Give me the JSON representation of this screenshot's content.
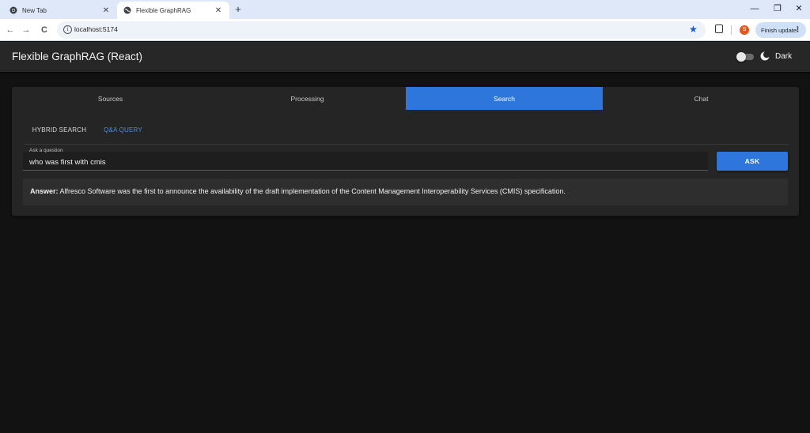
{
  "browser": {
    "tabs": [
      {
        "title": "New Tab",
        "icon": "chrome-icon",
        "active": false
      },
      {
        "title": "Flexible GraphRAG",
        "icon": "globe-icon",
        "active": true
      }
    ],
    "tab_close": "✕",
    "new_tab": "+",
    "window_controls": {
      "minimize": "—",
      "restore": "❐",
      "close": "✕"
    },
    "nav": {
      "back": "←",
      "forward": "→",
      "reload": "C"
    },
    "url": "localhost:5174",
    "info_icon": "i",
    "bookmark_icon": "★",
    "profile_initial": "S",
    "finish_update": "Finish update",
    "menu_icon": "⋮"
  },
  "app": {
    "title": "Flexible GraphRAG (React)",
    "theme_label": "Dark",
    "theme_dark_enabled": false,
    "tabs": [
      {
        "label": "Sources",
        "active": false
      },
      {
        "label": "Processing",
        "active": false
      },
      {
        "label": "Search",
        "active": true
      },
      {
        "label": "Chat",
        "active": false
      }
    ],
    "subtabs": [
      {
        "label": "HYBRID SEARCH",
        "active": false
      },
      {
        "label": "Q&A QUERY",
        "active": true
      }
    ],
    "question": {
      "label": "Ask a question",
      "value": "who was first with cmis"
    },
    "ask_button": "ASK",
    "answer": {
      "label": "Answer:",
      "text": "Alfresco Software was the first to announce the availability of the draft implementation of the Content Management Interoperability Services (CMIS) specification."
    }
  },
  "colors": {
    "accent": "#2f76dc",
    "background": "#121212",
    "card": "#252525",
    "appbar": "#272727",
    "tab_strip": "#dfe8f8"
  }
}
